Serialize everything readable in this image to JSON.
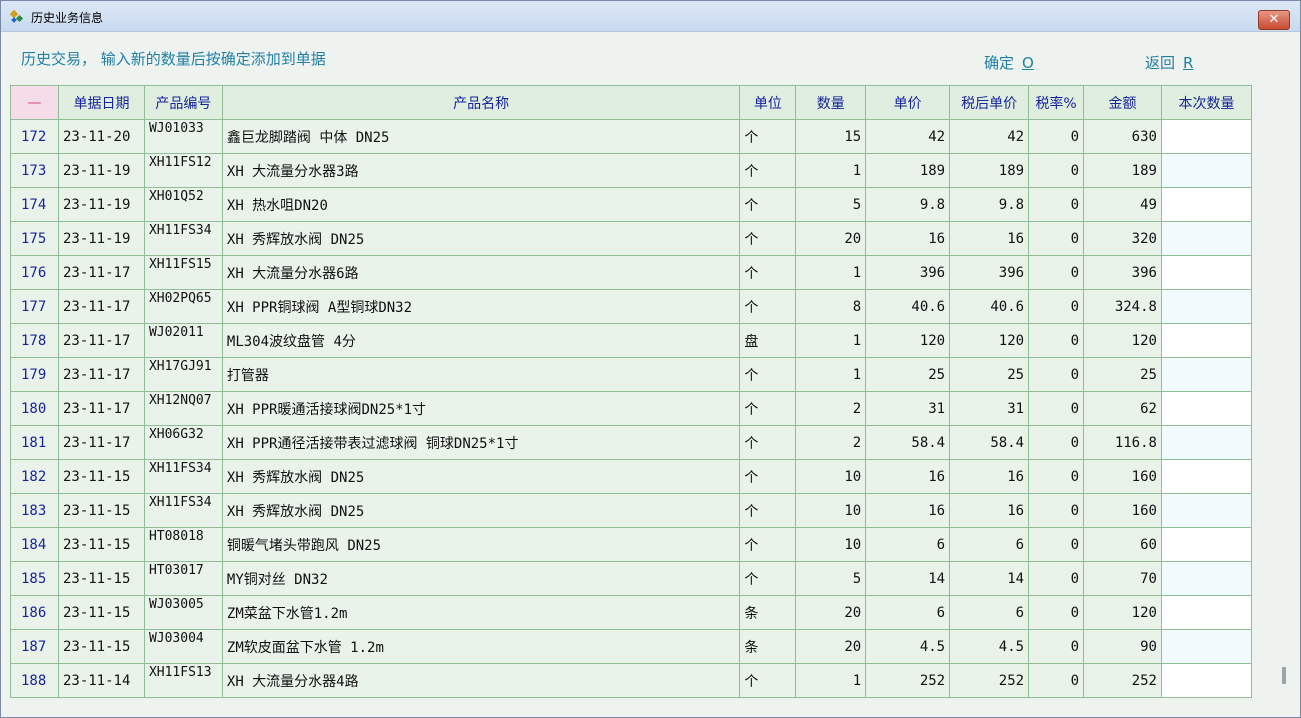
{
  "window": {
    "title": "历史业务信息",
    "close_label": "✕"
  },
  "toolbar": {
    "instruction": "历史交易， 输入新的数量后按确定添加到单据",
    "confirm_label": "确定",
    "confirm_hotkey": "O",
    "back_label": "返回",
    "back_hotkey": "R"
  },
  "table": {
    "headers": [
      "—",
      "单据日期",
      "产品编号",
      "产品名称",
      "单位",
      "数量",
      "单价",
      "税后单价",
      "税率%",
      "金额",
      "本次数量"
    ],
    "rows": [
      [
        "172",
        "23-11-20",
        "WJ01033",
        "鑫巨龙脚踏阀 中体 DN25",
        "个",
        "15",
        "42",
        "42",
        "0",
        "630",
        ""
      ],
      [
        "173",
        "23-11-19",
        "XH11FS12",
        "XH 大流量分水器3路",
        "个",
        "1",
        "189",
        "189",
        "0",
        "189",
        ""
      ],
      [
        "174",
        "23-11-19",
        "XH01Q52",
        "XH 热水咀DN20",
        "个",
        "5",
        "9.8",
        "9.8",
        "0",
        "49",
        ""
      ],
      [
        "175",
        "23-11-19",
        "XH11FS34",
        "XH 秀辉放水阀 DN25",
        "个",
        "20",
        "16",
        "16",
        "0",
        "320",
        ""
      ],
      [
        "176",
        "23-11-17",
        "XH11FS15",
        "XH 大流量分水器6路",
        "个",
        "1",
        "396",
        "396",
        "0",
        "396",
        ""
      ],
      [
        "177",
        "23-11-17",
        "XH02PQ65",
        "XH PPR铜球阀 A型铜球DN32",
        "个",
        "8",
        "40.6",
        "40.6",
        "0",
        "324.8",
        ""
      ],
      [
        "178",
        "23-11-17",
        "WJ02011",
        "ML304波纹盘管 4分",
        "盘",
        "1",
        "120",
        "120",
        "0",
        "120",
        ""
      ],
      [
        "179",
        "23-11-17",
        "XH17GJ91",
        "打管器",
        "个",
        "1",
        "25",
        "25",
        "0",
        "25",
        ""
      ],
      [
        "180",
        "23-11-17",
        "XH12NQ07",
        "XH PPR暖通活接球阀DN25*1寸",
        "个",
        "2",
        "31",
        "31",
        "0",
        "62",
        ""
      ],
      [
        "181",
        "23-11-17",
        "XH06G32",
        "XH PPR通径活接带表过滤球阀 铜球DN25*1寸",
        "个",
        "2",
        "58.4",
        "58.4",
        "0",
        "116.8",
        ""
      ],
      [
        "182",
        "23-11-15",
        "XH11FS34",
        "XH 秀辉放水阀 DN25",
        "个",
        "10",
        "16",
        "16",
        "0",
        "160",
        ""
      ],
      [
        "183",
        "23-11-15",
        "XH11FS34",
        "XH 秀辉放水阀 DN25",
        "个",
        "10",
        "16",
        "16",
        "0",
        "160",
        ""
      ],
      [
        "184",
        "23-11-15",
        "HT08018",
        "铜暖气堵头带跑风 DN25",
        "个",
        "10",
        "6",
        "6",
        "0",
        "60",
        ""
      ],
      [
        "185",
        "23-11-15",
        "HT03017",
        "MY铜对丝 DN32",
        "个",
        "5",
        "14",
        "14",
        "0",
        "70",
        ""
      ],
      [
        "186",
        "23-11-15",
        "WJ03005",
        "ZM菜盆下水管1.2m",
        "条",
        "20",
        "6",
        "6",
        "0",
        "120",
        ""
      ],
      [
        "187",
        "23-11-15",
        "WJ03004",
        "ZM软皮面盆下水管 1.2m",
        "条",
        "20",
        "4.5",
        "4.5",
        "0",
        "90",
        ""
      ],
      [
        "188",
        "23-11-14",
        "XH11FS13",
        "XH 大流量分水器4路",
        "个",
        "1",
        "252",
        "252",
        "0",
        "252",
        ""
      ]
    ]
  }
}
